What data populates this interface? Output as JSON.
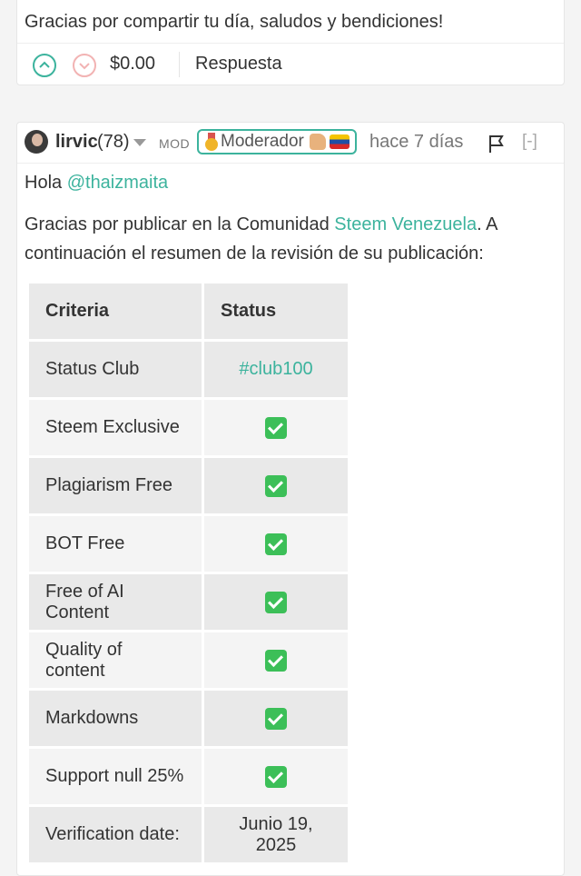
{
  "first_comment": {
    "text": "Gracias por compartir tu día, saludos y bendiciones!",
    "payout": "$0.00",
    "reply_label": "Respuesta"
  },
  "second_comment": {
    "author": "lirvic",
    "reputation": "(78)",
    "mod_label": "MOD",
    "badge_label": "Moderador",
    "time": "hace 7 días",
    "collapse_label": "[-]",
    "greeting": "Hola",
    "mention": "@thaizmaita",
    "para_before": "Gracias por publicar en la Comunidad ",
    "community_link": "Steem Venezuela",
    "para_after": ". A continuación el resumen de la revisión de su publicación:"
  },
  "review_table": {
    "headers": [
      "Criteria",
      "Status"
    ],
    "rows": [
      {
        "criteria": "Status Club",
        "status": "#club100",
        "kind": "tag"
      },
      {
        "criteria": "Steem Exclusive",
        "status": "✅",
        "kind": "check"
      },
      {
        "criteria": "Plagiarism Free",
        "status": "✅",
        "kind": "check"
      },
      {
        "criteria": "BOT Free",
        "status": "✅",
        "kind": "check"
      },
      {
        "criteria": "Free of AI Content",
        "status": "✅",
        "kind": "check"
      },
      {
        "criteria": "Quality of content",
        "status": "✅",
        "kind": "check"
      },
      {
        "criteria": "Markdowns",
        "status": "✅",
        "kind": "check"
      },
      {
        "criteria": "Support null 25%",
        "status": "✅",
        "kind": "check"
      },
      {
        "criteria": "Verification date:",
        "status": "Junio 19, 2025",
        "kind": "text"
      }
    ]
  },
  "colors": {
    "accent": "#3cb39d",
    "downvote": "#f2b3b3",
    "check": "#3cbf58"
  }
}
